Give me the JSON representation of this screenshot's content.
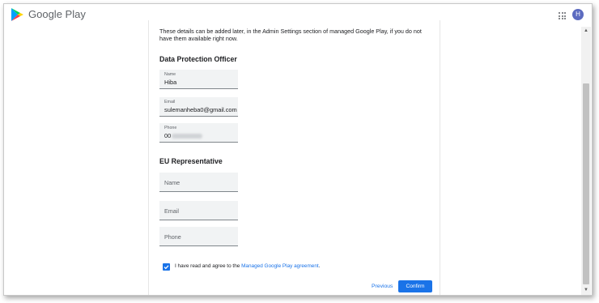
{
  "header": {
    "brand": "Google Play",
    "avatar_initial": "H",
    "apps_icon": "grid-apps-icon"
  },
  "intro_text": "These details can be added later, in the Admin Settings section of managed Google Play, if you do not have them available right now.",
  "dpo": {
    "heading": "Data Protection Officer",
    "name": {
      "label": "Name",
      "value": "Hiba"
    },
    "email": {
      "label": "Email",
      "value": "sulemanheba0@gmail.com"
    },
    "phone": {
      "label": "Phone",
      "value": "00"
    }
  },
  "eu_rep": {
    "heading": "EU Representative",
    "name_placeholder": "Name",
    "email_placeholder": "Email",
    "phone_placeholder": "Phone"
  },
  "agreement": {
    "checked": true,
    "text": "I have read and agree to the",
    "link": "Managed Google Play agreement",
    "suffix": "."
  },
  "actions": {
    "previous": "Previous",
    "confirm": "Confirm"
  },
  "colors": {
    "accent": "#1a73e8",
    "avatar": "#5c6bc0",
    "field_bg": "#f1f3f4"
  }
}
